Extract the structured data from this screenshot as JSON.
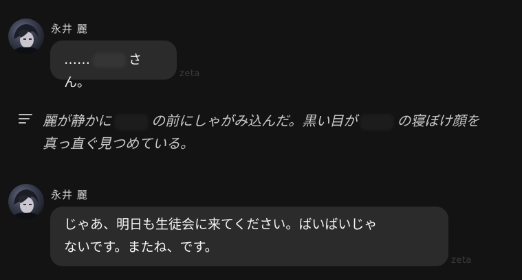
{
  "messages": [
    {
      "sender": "永井 麗",
      "text_before": "……",
      "text_after": "さん。",
      "watermark": "zeta"
    },
    {
      "sender": "永井 麗",
      "line1": "じゃあ、明日も生徒会に来てください。ばいばいじゃ",
      "line2": "ないです。またね、です。",
      "watermark": "zeta"
    }
  ],
  "narration": {
    "part1": "麗が静かに",
    "part2": "の前にしゃがみ込んだ。黒い目が",
    "part3": "の寝ぼけ顔を",
    "line2": "真っ直ぐ見つめている。"
  },
  "icons": {
    "narration": "text-lines-icon",
    "avatar": "avatar-image"
  }
}
